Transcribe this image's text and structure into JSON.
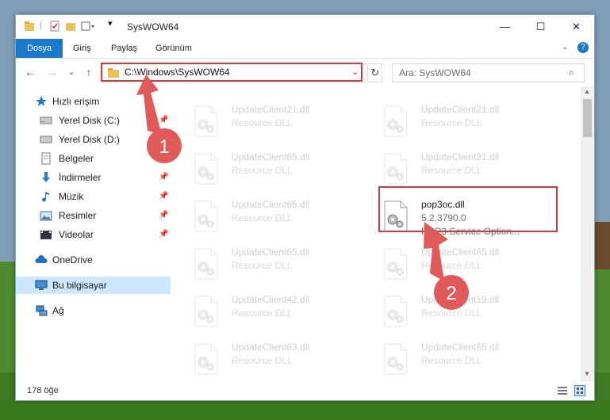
{
  "window": {
    "title": "SysWOW64",
    "min": "—",
    "max": "☐",
    "close": "✕"
  },
  "ribbon": {
    "tabs": [
      "Dosya",
      "Giriş",
      "Paylaş",
      "Görünüm"
    ],
    "help": "?"
  },
  "nav": {
    "back": "←",
    "forward": "→",
    "recent": "⌄",
    "up": "↑",
    "address": "C:\\Windows\\SysWOW64",
    "search_placeholder": "Ara: SysWOW64"
  },
  "sidebar": {
    "items": [
      {
        "label": "Hızlı erişim",
        "icon": "star-icon",
        "pinned": false
      },
      {
        "label": "Yerel Disk (C:)",
        "icon": "drive-icon",
        "pinned": true
      },
      {
        "label": "Yerel Disk (D:)",
        "icon": "drive-icon",
        "pinned": true
      },
      {
        "label": "Belgeler",
        "icon": "documents-icon",
        "pinned": true
      },
      {
        "label": "İndirmeler",
        "icon": "download-icon",
        "pinned": true
      },
      {
        "label": "Müzik",
        "icon": "music-icon",
        "pinned": true
      },
      {
        "label": "Resimler",
        "icon": "pictures-icon",
        "pinned": true
      },
      {
        "label": "Videolar",
        "icon": "videos-icon",
        "pinned": true
      },
      {
        "label": "OneDrive",
        "icon": "cloud-icon",
        "pinned": false
      },
      {
        "label": "Bu bilgisayar",
        "icon": "computer-icon",
        "pinned": false
      },
      {
        "label": "Ağ",
        "icon": "network-icon",
        "pinned": false
      }
    ]
  },
  "files": [
    {
      "name": "UpdateClient21.dll",
      "type": "Resource DLL"
    },
    {
      "name": "UpdateClient21.dll",
      "type": "Resource DLL"
    },
    {
      "name": "UpdateClient65.dll",
      "type": "Resource DLL"
    },
    {
      "name": "UpdateClient21.dll",
      "type": "Resource DLL"
    },
    {
      "name": "UpdateClient65.dll",
      "type": "Resource DLL"
    },
    {
      "name": "pop3oc.dll",
      "type": "5.2.3790.0",
      "desc": "POP3 Service Option..."
    },
    {
      "name": "UpdateClient65.dll",
      "type": "Resource DLL"
    },
    {
      "name": "UpdateClient65.dll",
      "type": "Resource DLL"
    },
    {
      "name": "UpdateClient42.dll",
      "type": "Resource DLL"
    },
    {
      "name": "UpdateClient19.dll",
      "type": "Resource DLL"
    },
    {
      "name": "UpdateClient63.dll",
      "type": "Resource DLL"
    },
    {
      "name": "UpdateClient65.dll",
      "type": "Resource DLL"
    }
  ],
  "status": {
    "count": "178 öğe"
  },
  "annotations": {
    "step1": "1",
    "step2": "2"
  },
  "colors": {
    "accent": "#1979ca",
    "highlight": "#d9363e",
    "arrow": "#e05a5a"
  }
}
